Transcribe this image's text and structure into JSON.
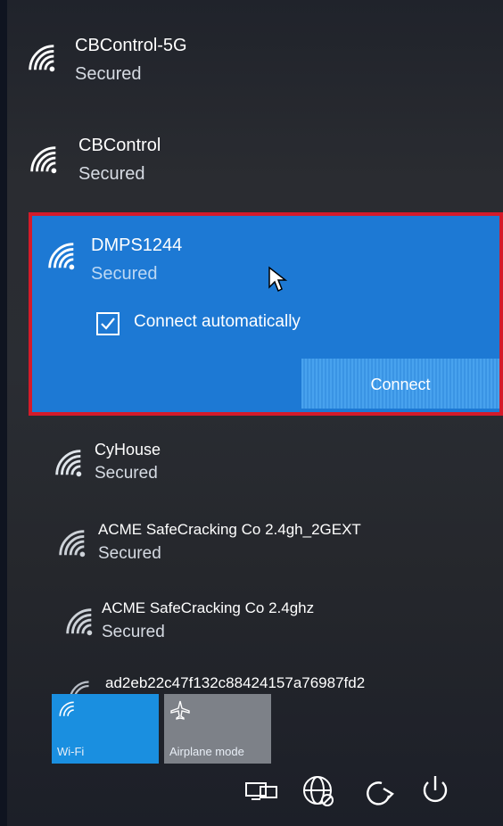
{
  "networks": [
    {
      "name": "CBControl-5G",
      "status": "Secured"
    },
    {
      "name": "CBControl",
      "status": "Secured"
    },
    {
      "name": "DMPS1244",
      "status": "Secured"
    },
    {
      "name": "CyHouse",
      "status": "Secured"
    },
    {
      "name": "ACME SafeCracking Co 2.4gh_2GEXT",
      "status": "Secured"
    },
    {
      "name": "ACME SafeCracking Co 2.4ghz",
      "status": "Secured"
    },
    {
      "name": "ad2eb22c47f132c88424157a76987fd2"
    }
  ],
  "selected": {
    "connect_auto_label": "Connect automatically",
    "connect_auto_checked": true,
    "connect_button_label": "Connect"
  },
  "quick_actions": [
    {
      "label": "Wi-Fi",
      "icon": "wifi-icon",
      "active": true
    },
    {
      "label": "Airplane mode",
      "icon": "airplane-icon",
      "active": false
    }
  ],
  "taskbar_icons": [
    "network-icon",
    "globe-icon",
    "sleep-icon",
    "power-icon"
  ],
  "colors": {
    "selected_bg": "#1d79d4",
    "highlight_border": "#d41b2a",
    "tile_active": "#1a8fe0"
  }
}
